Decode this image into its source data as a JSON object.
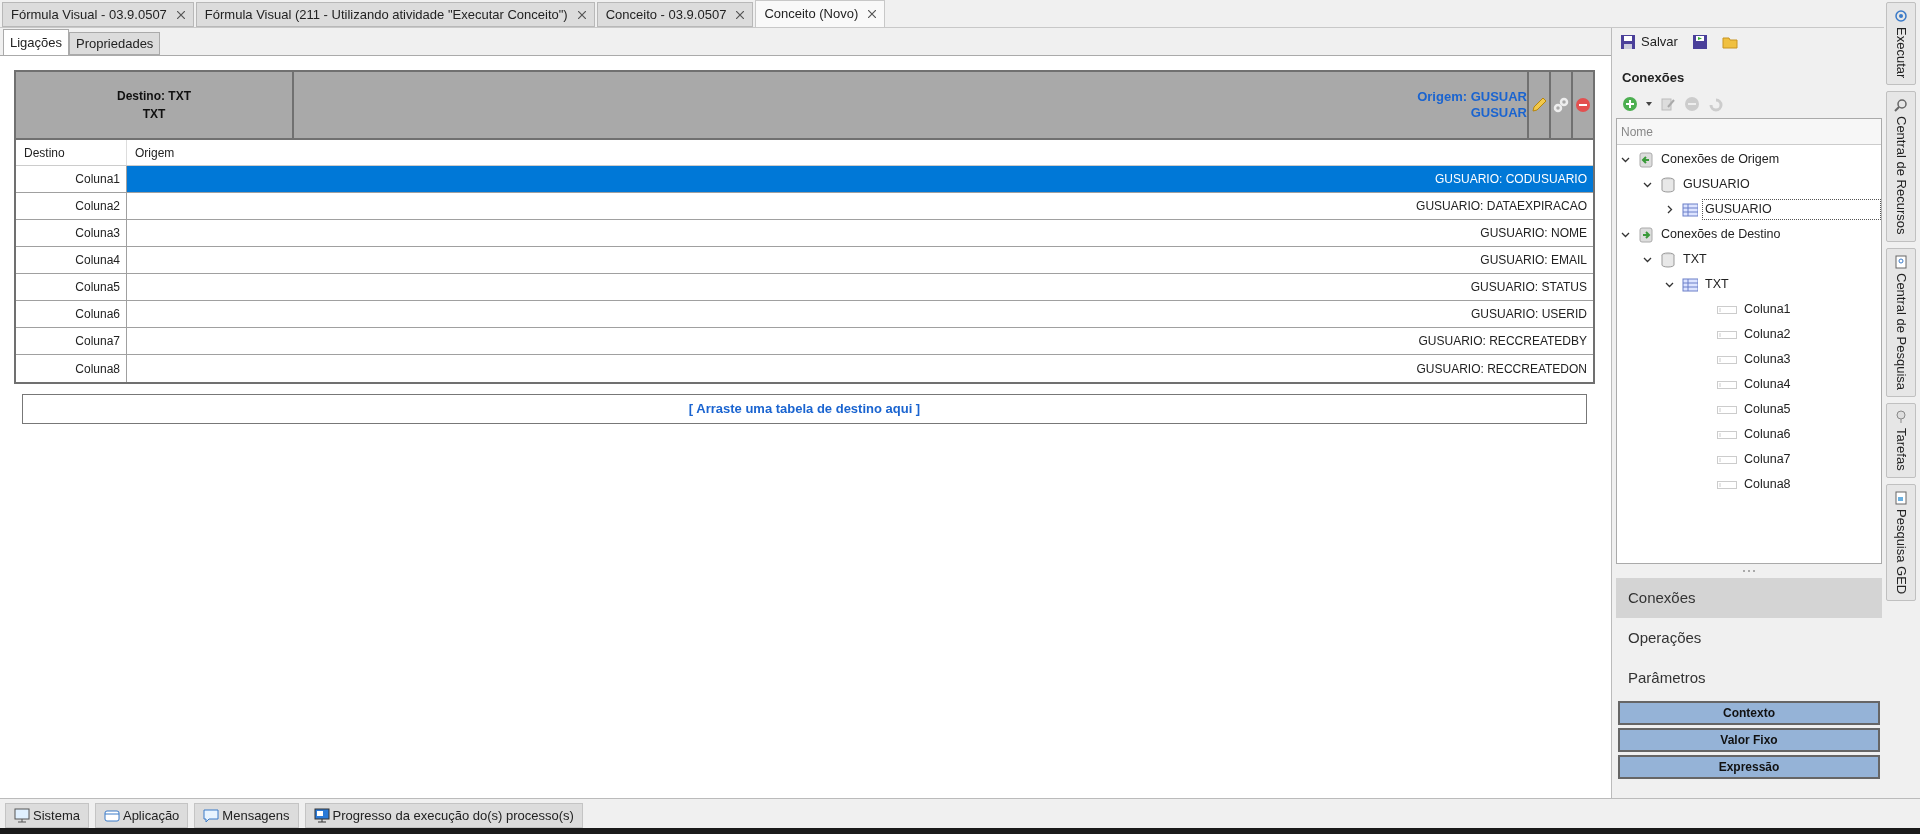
{
  "document_tabs": [
    {
      "label": "Fórmula Visual - 03.9.0507",
      "selected": false
    },
    {
      "label": "Fórmula Visual (211 - Utilizando atividade \"Executar Conceito\")",
      "selected": false
    },
    {
      "label": "Conceito - 03.9.0507",
      "selected": false
    },
    {
      "label": "Conceito (Novo)",
      "selected": true
    }
  ],
  "sub_tabs": [
    {
      "label": "Ligações",
      "selected": true
    },
    {
      "label": "Propriedades",
      "selected": false
    }
  ],
  "mapping": {
    "destination_title": "Destino: TXT",
    "destination_subtitle": "TXT",
    "origin_title": "Origem: GUSUAR",
    "origin_subtitle": "GUSUAR",
    "columns": [
      "Destino",
      "Origem"
    ],
    "rows": [
      {
        "destino": "Coluna1",
        "origem": "GUSUARIO: CODUSUARIO",
        "selected": true
      },
      {
        "destino": "Coluna2",
        "origem": "GUSUARIO: DATAEXPIRACAO",
        "selected": false
      },
      {
        "destino": "Coluna3",
        "origem": "GUSUARIO: NOME",
        "selected": false
      },
      {
        "destino": "Coluna4",
        "origem": "GUSUARIO: EMAIL",
        "selected": false
      },
      {
        "destino": "Coluna5",
        "origem": "GUSUARIO: STATUS",
        "selected": false
      },
      {
        "destino": "Coluna6",
        "origem": "GUSUARIO: USERID",
        "selected": false
      },
      {
        "destino": "Coluna7",
        "origem": "GUSUARIO: RECCREATEDBY",
        "selected": false
      },
      {
        "destino": "Coluna8",
        "origem": "GUSUARIO: RECCREATEDON",
        "selected": false
      }
    ]
  },
  "drop_zone": "[ Arraste uma tabela de destino aqui ]",
  "right_panel": {
    "save_label": "Salvar",
    "heading": "Conexões",
    "tree_header": "Nome",
    "tree": [
      {
        "label": "Conexões de Origem",
        "kind": "source",
        "expanded": true,
        "selected": false,
        "children": [
          {
            "label": "GUSUARIO",
            "kind": "database",
            "expanded": true,
            "selected": false,
            "children": [
              {
                "label": "GUSUARIO",
                "kind": "table",
                "expanded": false,
                "selected": true
              }
            ]
          }
        ]
      },
      {
        "label": "Conexões de Destino",
        "kind": "target",
        "expanded": true,
        "selected": false,
        "children": [
          {
            "label": "TXT",
            "kind": "database",
            "expanded": true,
            "selected": false,
            "children": [
              {
                "label": "TXT",
                "kind": "table",
                "expanded": true,
                "selected": false,
                "children": [
                  {
                    "label": "Coluna1",
                    "kind": "column",
                    "selected": false
                  },
                  {
                    "label": "Coluna2",
                    "kind": "column",
                    "selected": false
                  },
                  {
                    "label": "Coluna3",
                    "kind": "column",
                    "selected": false
                  },
                  {
                    "label": "Coluna4",
                    "kind": "column",
                    "selected": false
                  },
                  {
                    "label": "Coluna5",
                    "kind": "column",
                    "selected": false
                  },
                  {
                    "label": "Coluna6",
                    "kind": "column",
                    "selected": false
                  },
                  {
                    "label": "Coluna7",
                    "kind": "column",
                    "selected": false
                  },
                  {
                    "label": "Coluna8",
                    "kind": "column",
                    "selected": false
                  }
                ]
              }
            ]
          }
        ]
      }
    ],
    "nav": [
      {
        "label": "Conexões",
        "selected": true
      },
      {
        "label": "Operações",
        "selected": false
      },
      {
        "label": "Parâmetros",
        "selected": false
      }
    ],
    "buttons": [
      "Contexto",
      "Valor Fixo",
      "Expressão"
    ]
  },
  "side_tabs": [
    "Executar",
    "Central de Recursos",
    "Central de Pesquisa",
    "Tarefas",
    "Pesquisa GED"
  ],
  "bottom_tabs": [
    "Sistema",
    "Aplicação",
    "Mensagens",
    "Progresso da execução do(s) processo(s)"
  ]
}
